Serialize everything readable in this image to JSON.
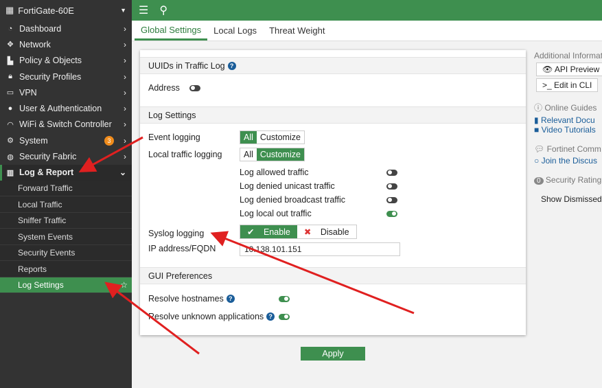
{
  "sidebar": {
    "device": "FortiGate-60E",
    "items": [
      {
        "label": "Dashboard",
        "icon": "dashboard-icon"
      },
      {
        "label": "Network",
        "icon": "network-icon"
      },
      {
        "label": "Policy & Objects",
        "icon": "policy-icon"
      },
      {
        "label": "Security Profiles",
        "icon": "lock-icon"
      },
      {
        "label": "VPN",
        "icon": "laptop-icon"
      },
      {
        "label": "User & Authentication",
        "icon": "user-icon"
      },
      {
        "label": "WiFi & Switch Controller",
        "icon": "wifi-icon"
      },
      {
        "label": "System",
        "icon": "gear-icon",
        "badge": "3"
      },
      {
        "label": "Security Fabric",
        "icon": "fabric-icon"
      },
      {
        "label": "Log & Report",
        "icon": "chart-icon"
      }
    ],
    "subitems": [
      "Forward Traffic",
      "Local Traffic",
      "Sniffer Traffic",
      "System Events",
      "Security Events",
      "Reports",
      "Log Settings"
    ]
  },
  "tabs": [
    "Global Settings",
    "Local Logs",
    "Threat Weight"
  ],
  "card": {
    "uuid_section": "UUIDs in Traffic Log",
    "address_label": "Address",
    "address_on": false,
    "log_section": "Log Settings",
    "event_logging": "Event logging",
    "local_traffic_logging": "Local traffic logging",
    "all": "All",
    "customize": "Customize",
    "toggles": [
      {
        "label": "Log allowed traffic",
        "on": false
      },
      {
        "label": "Log denied unicast traffic",
        "on": false
      },
      {
        "label": "Log denied broadcast traffic",
        "on": false
      },
      {
        "label": "Log local out traffic",
        "on": true
      }
    ],
    "syslog": "Syslog logging",
    "enable": "Enable",
    "disable": "Disable",
    "ip_label": "IP address/FQDN",
    "ip_value": "10.138.101.151",
    "gui_section": "GUI Preferences",
    "resolve_hostnames": "Resolve hostnames",
    "resolve_apps": "Resolve unknown applications"
  },
  "apply": "Apply",
  "right": {
    "title": "Additional Informat",
    "api": "API Preview",
    "cli": "Edit in CLI",
    "guides": "Online Guides",
    "docs": "Relevant Docu",
    "videos": "Video Tutorials",
    "community": "Fortinet Comm",
    "join": "Join the Discus",
    "rating_badge": "0",
    "rating": "Security Rating",
    "dismissed": "Show Dismissed"
  },
  "colors": {
    "accent": "#3e8f4f",
    "sidebar": "#333333",
    "annotation": "#e02020"
  }
}
